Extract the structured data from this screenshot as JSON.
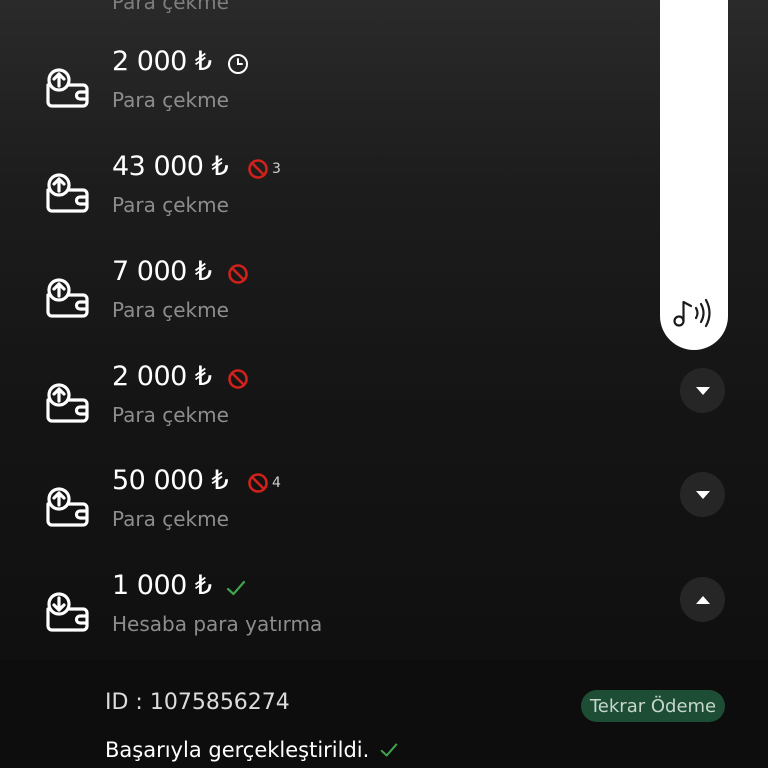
{
  "colors": {
    "background_top": "#2a2a2a",
    "background_bottom": "#0e0e0e",
    "rejected": "#d0211b",
    "success": "#3fa34d",
    "retry_button_bg": "#1d4d35",
    "expand_button_bg": "#262626"
  },
  "partial_top_item": {
    "label": "Para çekme"
  },
  "transactions": [
    {
      "amount": "2 000 ₺",
      "type": "Para çekme",
      "icon": "wallet-withdraw-icon",
      "status": "pending",
      "status_icon": "clock-icon",
      "count": ""
    },
    {
      "amount": "43 000 ₺",
      "type": "Para çekme",
      "icon": "wallet-withdraw-icon",
      "status": "rejected",
      "status_icon": "blocked-icon",
      "count": "3"
    },
    {
      "amount": "7 000 ₺",
      "type": "Para çekme",
      "icon": "wallet-withdraw-icon",
      "status": "rejected",
      "status_icon": "blocked-icon",
      "count": ""
    },
    {
      "amount": "2 000 ₺",
      "type": "Para çekme",
      "icon": "wallet-withdraw-icon",
      "status": "rejected",
      "status_icon": "blocked-icon",
      "count": "",
      "toggle": "chevron-down-icon"
    },
    {
      "amount": "50 000 ₺",
      "type": "Para çekme",
      "icon": "wallet-withdraw-icon",
      "status": "rejected",
      "status_icon": "blocked-icon",
      "count": "4",
      "toggle": "chevron-down-icon"
    },
    {
      "amount": "1 000 ₺",
      "type": "Hesaba para yatırma",
      "icon": "wallet-deposit-icon",
      "status": "success",
      "status_icon": "check-icon",
      "count": "",
      "toggle": "chevron-up-icon"
    }
  ],
  "details": {
    "id_text": "ID : 1075856274",
    "retry_label": "Tekrar Ödeme",
    "status_text": "Başarıyla gerçekleştirildi."
  },
  "audio_panel": {
    "icon": "music-sound-icon"
  }
}
